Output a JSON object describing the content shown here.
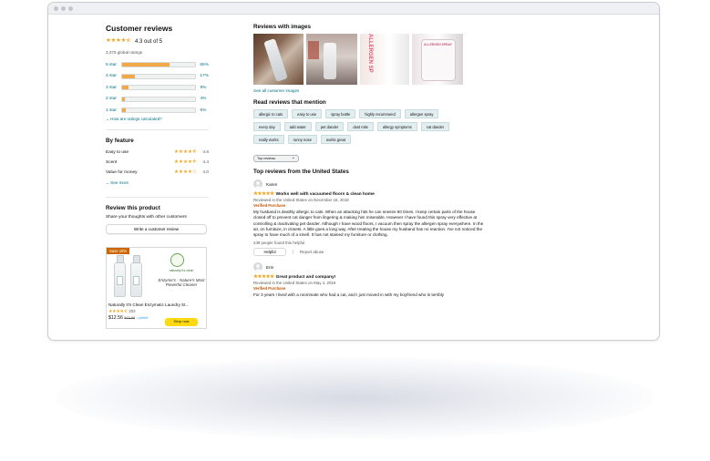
{
  "summary": {
    "title": "Customer reviews",
    "stars": "★★★★⯪",
    "rating_text": "4.3 out of 5",
    "global_ratings": "3,375 global ratings",
    "histogram": [
      {
        "label": "5 star",
        "pct": "65%",
        "value": 65
      },
      {
        "label": "4 star",
        "pct": "17%",
        "value": 17
      },
      {
        "label": "3 star",
        "pct": "9%",
        "value": 9
      },
      {
        "label": "2 star",
        "pct": "4%",
        "value": 4
      },
      {
        "label": "1 star",
        "pct": "5%",
        "value": 5
      }
    ],
    "how_calculated": "How are ratings calculated?"
  },
  "by_feature": {
    "title": "By feature",
    "items": [
      {
        "name": "Easy to use",
        "stars": "★★★★⯪",
        "value": "4.6"
      },
      {
        "name": "Scent",
        "stars": "★★★★⯪",
        "value": "4.4"
      },
      {
        "name": "Value for money",
        "stars": "★★★★☆",
        "value": "4.0"
      }
    ],
    "see_more": "See more"
  },
  "review_product": {
    "title": "Review this product",
    "subtitle": "Share your thoughts with other customers",
    "button": "Write a customer review"
  },
  "ad": {
    "badge": "Save 10%",
    "brand": "naturally it's clean",
    "tagline": "Enzyme's - Nature's Most Powerful Cleaner",
    "product_title": "Naturally It's Clean Enzymatic Laundry St...",
    "stars": "★★★★⯪",
    "rating_count": "203",
    "price": "$12.56",
    "list_price": "$13.95",
    "prime": "✓prime",
    "shop_button": "Shop now"
  },
  "images": {
    "title": "Reviews with images",
    "see_all": "See all customer images",
    "image_texts": [
      "",
      "",
      "ALLERGEN SP",
      "ALLERGEN SPRAY"
    ]
  },
  "mentions": {
    "title": "Read reviews that mention",
    "chips": [
      "allergic to cats",
      "easy to use",
      "spray bottle",
      "highly recommend",
      "allergen spray",
      "every day",
      "add water",
      "pet dander",
      "dust mite",
      "allergy symptoms",
      "cat dander",
      "really works",
      "runny nose",
      "works great"
    ]
  },
  "sort": {
    "selected": "Top reviews"
  },
  "top_reviews": {
    "title": "Top reviews from the United States",
    "reviews": [
      {
        "author": "Karen",
        "stars": "★★★★★",
        "title": "Works well with vacuumed floors & clean home",
        "date": "Reviewed in the United States on December 16, 2018",
        "verified": "Verified Purchase",
        "body": "My husband is deathly allergic to cats. When an attacking hits he can sneeze 50 times. I keep certain parts of the house closed off to prevent cat danger from lingering & making him miserable. However I have found this spray very effective at controlling & inactivating pet dander. Although I have wood floors, I vacuum then spray the allergen spray everywhere. In the air, on furniture, in closets. A little goes a long way. After treating the house my husband has no reaction. I've not noticed the spray to have much of a smell. It has not stained my furniture or clothing.",
        "helpful_count": "249 people found this helpful",
        "helpful_button": "Helpful",
        "report": "Report abuse"
      },
      {
        "author": "Erin",
        "stars": "★★★★★",
        "title": "Great product and company!",
        "date": "Reviewed in the United States on May 4, 2019",
        "verified": "Verified Purchase",
        "body": "For 3 years I lived with a roommate who had a cat, and I just moved in with my boyfriend who is terribly"
      }
    ]
  },
  "colors": {
    "star": "#f0a61f",
    "bar": "#f3a847",
    "link": "#007185",
    "verified": "#c45500"
  }
}
